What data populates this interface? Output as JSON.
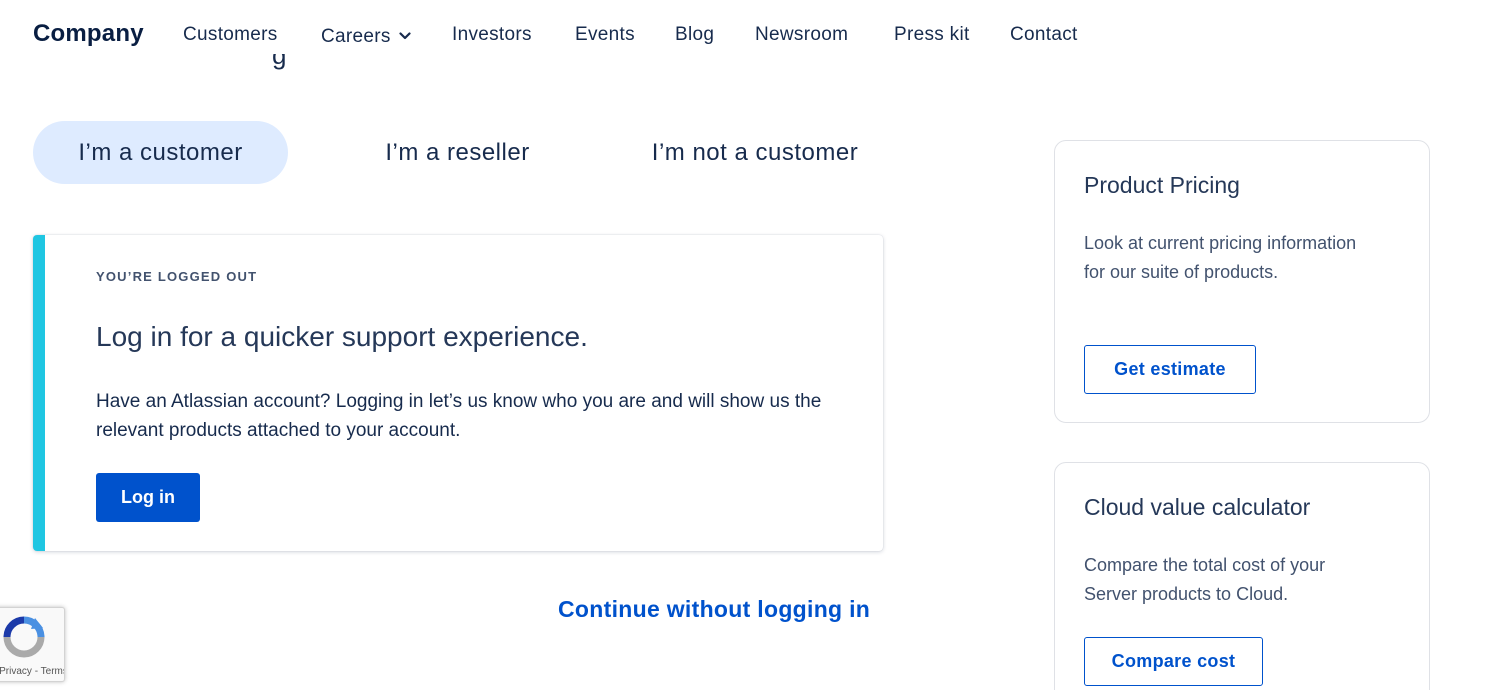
{
  "nav": {
    "brand": "Company",
    "links": [
      {
        "label": "Customers"
      },
      {
        "label": "Careers"
      },
      {
        "label": "Investors"
      },
      {
        "label": "Events"
      },
      {
        "label": "Blog"
      },
      {
        "label": "Newsroom"
      },
      {
        "label": "Press kit"
      },
      {
        "label": "Contact"
      }
    ],
    "careers_icon": "chevron-down-icon"
  },
  "peek_text": "g",
  "tabs": [
    {
      "label": "I’m a customer",
      "active": true
    },
    {
      "label": "I’m a reseller",
      "active": false
    },
    {
      "label": "I’m not a customer",
      "active": false
    }
  ],
  "login_card": {
    "eyebrow": "YOU’RE LOGGED OUT",
    "title": "Log in for a quicker support experience.",
    "description": "Have an Atlassian account? Logging in let’s us know who you are and will show us the relevant products attached to your account.",
    "button": "Log in",
    "accent_color": "#1fc6e2"
  },
  "continue_link": "Continue without logging in",
  "side_cards": {
    "pricing": {
      "title": "Product Pricing",
      "description": "Look at current pricing information for our suite of products.",
      "button": "Get estimate"
    },
    "calculator": {
      "title": "Cloud value calculator",
      "description": "Compare the total cost of your Server products to Cloud.",
      "button": "Compare cost"
    }
  },
  "recaptcha": {
    "links": "Privacy - Terms",
    "icon": "recaptcha-icon"
  },
  "colors": {
    "primary": "#0052cc",
    "active_tab_bg": "#deebff",
    "text_dark": "#172b4d"
  }
}
